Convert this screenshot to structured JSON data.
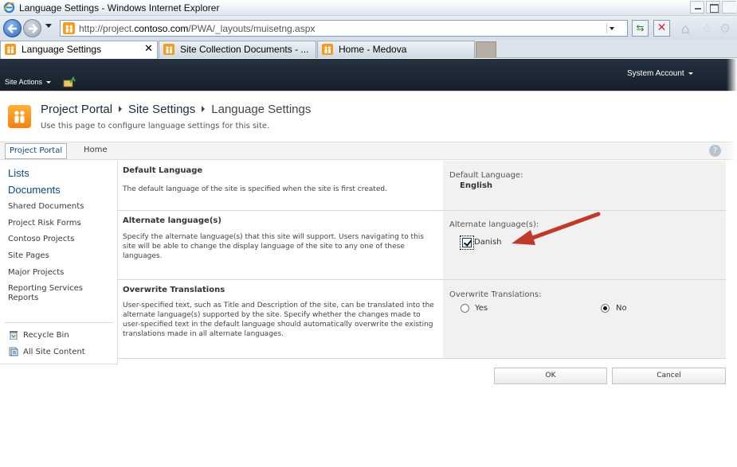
{
  "browser": {
    "window_title": "Language Settings - Windows Internet Explorer",
    "url_prefix": "http://project.",
    "url_domain": "contoso.com",
    "url_path": "/PWA/_layouts/muisetng.aspx",
    "tabs": [
      {
        "label": "Language Settings"
      },
      {
        "label": "Site Collection Documents - ..."
      },
      {
        "label": "Home - Medova"
      }
    ],
    "close_tab_glyph": "✕"
  },
  "ribbon": {
    "site_actions": "Site Actions",
    "account": "System Account"
  },
  "header": {
    "breadcrumb": [
      "Project Portal",
      "Site Settings",
      "Language Settings"
    ],
    "description": "Use this page to configure language settings for this site."
  },
  "topnav": {
    "items": [
      "Project Portal",
      "Home"
    ]
  },
  "quicklaunch": {
    "headings": [
      "Lists",
      "Documents"
    ],
    "items": [
      "Shared Documents",
      "Project Risk Forms",
      "Contoso Projects",
      "Site Pages",
      "Major Projects",
      "Reporting Services Reports"
    ],
    "recycle_bin": "Recycle Bin",
    "all_site_content": "All Site Content"
  },
  "sections": {
    "default_language": {
      "title": "Default Language",
      "description": "The default language of the site is specified when the site is first created.",
      "field_label": "Default Language:",
      "value": "English"
    },
    "alternate_languages": {
      "title": "Alternate language(s)",
      "description": "Specify the alternate language(s) that this site will support. Users navigating to this site will be able to change the display language of the site to any one of these languages.",
      "field_label": "Alternate language(s):",
      "option": "Danish",
      "checked": true
    },
    "overwrite_translations": {
      "title": "Overwrite Translations",
      "description": "User-specified text, such as Title and Description of the site, can be translated into the alternate language(s) supported by the site. Specify whether the changes made to user-specified text in the default language should automatically overwrite the existing translations made in all alternate languages.",
      "field_label": "Overwrite Translations:",
      "options": [
        "Yes",
        "No"
      ],
      "selected": "No"
    }
  },
  "buttons": {
    "ok": "OK",
    "cancel": "Cancel"
  },
  "colors": {
    "ribbon_bg": "#1b2632",
    "link_blue": "#0b4a7e",
    "annotation_arrow": "#c0392b",
    "field_panel_bg": "#f1f1f1"
  },
  "icons": [
    "ie-icon",
    "back-icon",
    "forward-icon",
    "home-icon",
    "favorites-star-icon",
    "tools-gear-icon",
    "close-icon",
    "navigate-up-icon",
    "sharepoint-logo-icon",
    "help-icon",
    "recycle-bin-icon",
    "all-site-content-icon",
    "annotation-arrow"
  ]
}
